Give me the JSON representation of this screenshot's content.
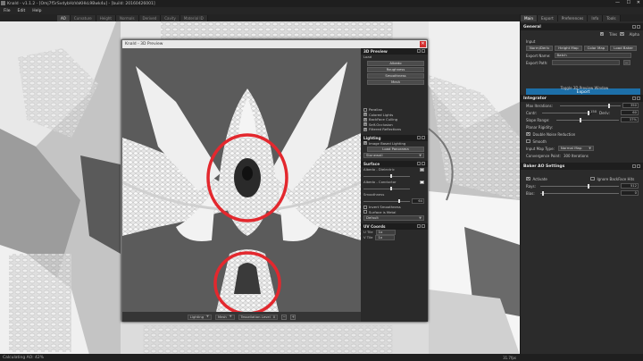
{
  "window": {
    "title": "Knald - v1.1.2 - [Omj7f5rSvdybHzVaKHkL9Bwk4u] - [build: 20160426001]",
    "controls": [
      "—",
      "☐",
      "✕"
    ]
  },
  "menu": [
    "File",
    "Edit",
    "Help"
  ],
  "doc_tabs": [
    {
      "label": "AO",
      "active": true
    },
    {
      "label": "Curvature",
      "active": false
    },
    {
      "label": "Height",
      "active": false
    },
    {
      "label": "Normals",
      "active": false
    },
    {
      "label": "Derived",
      "active": false
    },
    {
      "label": "Cavity",
      "active": false
    },
    {
      "label": "Material ID",
      "active": false
    }
  ],
  "status": {
    "text": "Calculating AO: 42%",
    "zoom": "31.7fps"
  },
  "preview": {
    "title": "Knald - 3D Preview",
    "close": "✕",
    "bottom": {
      "mode": "Lighting",
      "mesh": "Mesh",
      "tess": "Tessellation Level",
      "tess_val": "0"
    },
    "sections": {
      "preview": {
        "title": "3D Preview",
        "load_label": "Load",
        "load_buttons": [
          "Albedo",
          "Roughness",
          "Smoothness",
          "Mesh"
        ],
        "dim_rows": [
          "",
          "",
          "",
          ""
        ],
        "checks": [
          {
            "label": "Parallax",
            "on": false
          },
          {
            "label": "Colored Lights",
            "on": true
          },
          {
            "label": "BackFace Culling",
            "on": true
          },
          {
            "label": "Self-Occlusion",
            "on": true
          },
          {
            "label": "Filtered Reflections",
            "on": true
          }
        ]
      },
      "lighting": {
        "title": "Lighting",
        "ibl": {
          "label": "Image Based Lighting",
          "on": true
        },
        "load_pan": "Load Panorama",
        "env": "Stonewall"
      },
      "surface": {
        "title": "Surface",
        "albedo_d": "Albedo - Dielectric",
        "albedo_c": "Albedo - Conductor",
        "smooth_label": "Smoothness",
        "smooth_val": "64",
        "invert": {
          "label": "Invert Smoothness",
          "on": false
        },
        "metal": {
          "label": "Surface is Metal",
          "on": false
        },
        "default": "Default"
      },
      "uv": {
        "title": "UV Coords",
        "utile": "U Tile",
        "utile_val": "1x",
        "vtile": "V Tile",
        "vtile_val": "1x"
      }
    }
  },
  "panel": {
    "tabs": [
      {
        "label": "Main",
        "active": true
      },
      {
        "label": "Export",
        "active": false
      },
      {
        "label": "Preferences",
        "active": false
      },
      {
        "label": "Info",
        "active": false
      },
      {
        "label": "Tools",
        "active": false
      }
    ],
    "general": {
      "title": "General",
      "tiles": {
        "label": "Tiles",
        "on": true
      },
      "alpha": {
        "label": "Alpha",
        "on": true
      },
      "input": "Input",
      "buttons": [
        "Norm/Deriv",
        "Height Map",
        "Color Map",
        "Load Baker"
      ],
      "export_name_label": "Export Name:",
      "export_name": "Batch",
      "export_path_label": "Export Path:",
      "export": "Export",
      "toggle": "Toggle 3D Preview Window"
    },
    "integrator": {
      "title": "Integrator",
      "max_iter_label": "Max Iterations:",
      "max_iter": "350",
      "contr_label": "Contr:",
      "contr": "150",
      "deriv_label": "Deriv:",
      "deriv": "60",
      "slope_label": "Slope Range:",
      "slope": "37%",
      "planar": "Planar Rigidity:",
      "double_noise": {
        "label": "Double Noise Reduction",
        "on": true
      },
      "smooth": {
        "label": "Smooth",
        "on": false
      },
      "input_map_label": "Input Map Type:",
      "input_map": "Normal Map",
      "convergence_label": "Convergence Point:",
      "convergence": "300 Iterations"
    },
    "baker": {
      "title": "Baker AO Settings",
      "activate": {
        "label": "Activate",
        "on": true
      },
      "ignore": {
        "label": "Ignore BackFace Hits",
        "on": false
      },
      "rays_label": "Rays:",
      "rays": "512",
      "bias_label": "Bias:",
      "bias": "0"
    }
  },
  "colors": {
    "accent": "#1d6fa8",
    "annotation": "#e3282e",
    "close": "#d32f2f"
  }
}
